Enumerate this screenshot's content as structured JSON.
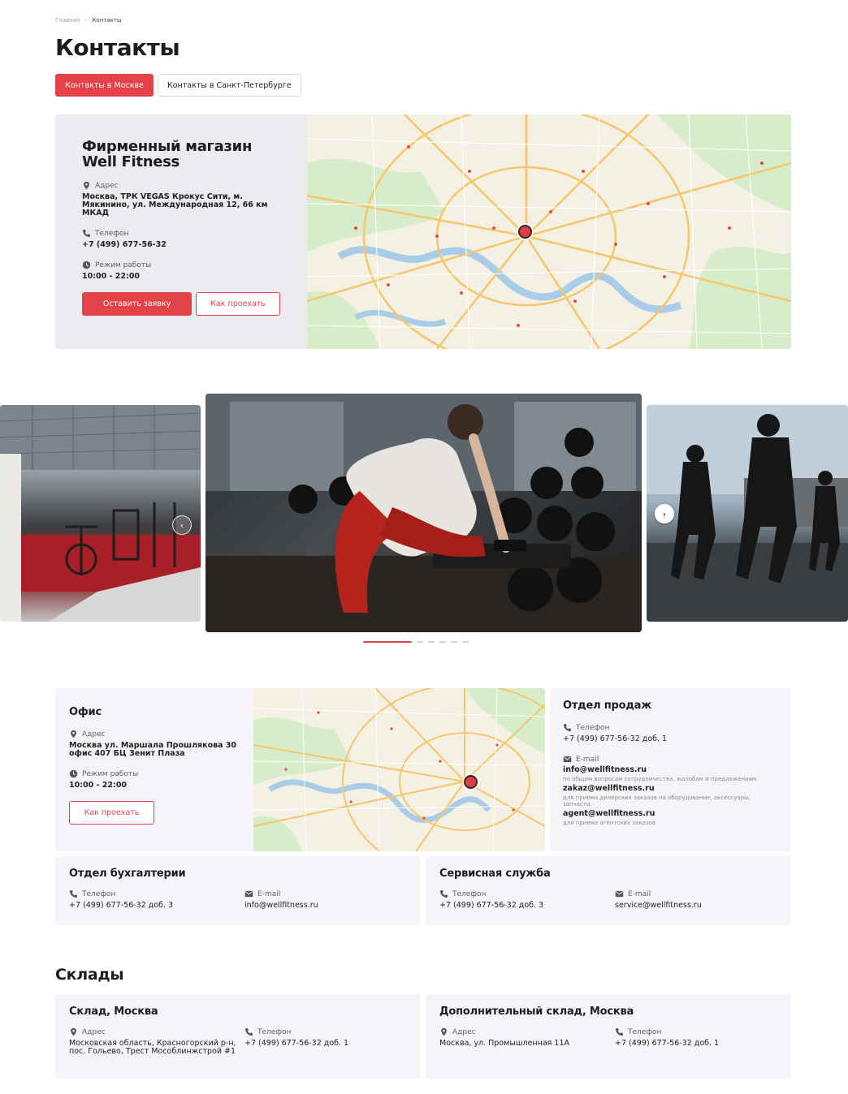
{
  "breadcrumb": {
    "home": "Главная",
    "current": "Контакты"
  },
  "page_title": "Контакты",
  "tabs": [
    {
      "label": "Контакты в Москве",
      "active": true
    },
    {
      "label": "Контакты в Санкт-Петербурге",
      "active": false
    }
  ],
  "store": {
    "title": "Фирменный магазин Well Fitness",
    "address_label": "Адрес",
    "address": "Москва, ТРК VEGAS Крокус Сити, м. Мякинино, ул. Международная 12, 66 км МКАД",
    "phone_label": "Телефон",
    "phone": "+7 (499) 677-56-32",
    "hours_label": "Режим работы",
    "hours": "10:00 - 22:00",
    "request_button": "Оставить заявку",
    "route_button": "Как проехать"
  },
  "gallery": {
    "slides": 7,
    "active_index": 0
  },
  "office": {
    "title": "Офис",
    "address_label": "Адрес",
    "address": "Москва ул. Маршала Прошлякова 30 офис 407 БЦ Зенит Плаза",
    "hours_label": "Режим работы",
    "hours": "10:00 - 22:00",
    "route_button": "Как проехать"
  },
  "sales": {
    "title": "Отдел продаж",
    "phone_label": "Телефон",
    "phone": "+7 (499) 677-56-32 доб. 1",
    "email_label": "E-mail",
    "emails": [
      {
        "address": "info@wellfitness.ru",
        "note": "по общим вопросам сотрудничества, жалобам и предложениям."
      },
      {
        "address": "zakaz@wellfitness.ru",
        "note": "для приема дилерских заказов на оборудование, аксессуары, запчасти."
      },
      {
        "address": "agent@wellfitness.ru",
        "note": "для приема агентских заказов"
      }
    ]
  },
  "accounting": {
    "title": "Отдел бухгалтерии",
    "phone_label": "Телефон",
    "phone": "+7 (499) 677-56-32 доб. 3",
    "email_label": "E-mail",
    "email": "info@wellfitness.ru"
  },
  "service": {
    "title": "Сервисная служба",
    "phone_label": "Телефон",
    "phone": "+7 (499) 677-56-32 доб. 3",
    "email_label": "E-mail",
    "email": "service@wellfitness.ru"
  },
  "warehouses_title": "Склады",
  "warehouse_main": {
    "title": "Склад, Москва",
    "address_label": "Адрес",
    "address": "Московская область, Красногорский р-н, пос. Гольево, Трест Мособлинжстрой #1",
    "phone_label": "Телефон",
    "phone": "+7 (499) 677-56-32 доб. 1"
  },
  "warehouse_extra": {
    "title": "Дополнительный склад, Москва",
    "address_label": "Адрес",
    "address": "Москва, ул. Промышленная 11А",
    "phone_label": "Телефон",
    "phone": "+7 (499) 677-56-32 доб. 1"
  },
  "colors": {
    "accent": "#e34248",
    "card_bg": "#f5f5f9",
    "store_bg": "#ebebf0"
  },
  "icons": {
    "address": "location-pin-icon",
    "phone": "phone-icon",
    "hours": "clock-icon",
    "email": "mail-icon",
    "prev": "chevron-left-icon",
    "next": "chevron-right-icon"
  }
}
